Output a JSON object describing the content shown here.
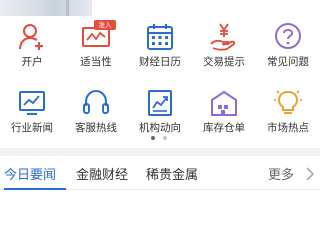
{
  "menu": {
    "row1": [
      {
        "label": "开户",
        "icon": "user-add-icon"
      },
      {
        "label": "适当性",
        "icon": "chart-monitor-icon",
        "badge": "准入"
      },
      {
        "label": "财经日历",
        "icon": "calendar-icon"
      },
      {
        "label": "交易提示",
        "icon": "yen-hand-icon"
      },
      {
        "label": "常见问题",
        "icon": "question-icon"
      }
    ],
    "row2": [
      {
        "label": "行业新闻",
        "icon": "news-monitor-icon"
      },
      {
        "label": "客服热线",
        "icon": "headset-icon"
      },
      {
        "label": "机构动向",
        "icon": "trend-doc-icon"
      },
      {
        "label": "库存仓单",
        "icon": "warehouse-icon"
      },
      {
        "label": "市场热点",
        "icon": "lightbulb-icon"
      }
    ]
  },
  "pager": {
    "count": 2,
    "active": 1
  },
  "tabs": {
    "items": [
      "今日要闻",
      "金融财经",
      "稀贵金属"
    ],
    "active_index": 0,
    "more_label": "更多"
  },
  "colors": {
    "red": "#e84a3c",
    "blue": "#2b6cd6",
    "purple": "#8e6bd8",
    "orange": "#f0a030"
  }
}
